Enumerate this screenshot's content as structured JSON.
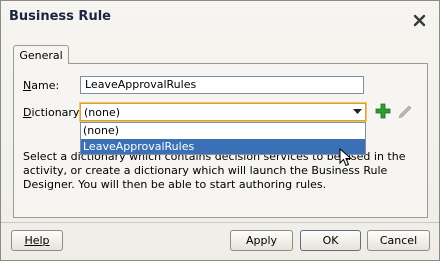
{
  "dialog": {
    "title": "Business Rule"
  },
  "tabs": [
    {
      "label": "General"
    }
  ],
  "form": {
    "name_label_prefix": "N",
    "name_label_rest": "ame:",
    "name_value": "LeaveApprovalRules",
    "dictionary_label_prefix": "D",
    "dictionary_label_rest": "ictionary:",
    "dictionary_selected": "(none)",
    "dictionary_options": [
      "(none)",
      "LeaveApprovalRules"
    ],
    "help_text": "Select a dictionary which contains decision services to be used in the activity, or create a dictionary which will launch the Business Rule Designer. You will then be able to start authoring rules."
  },
  "buttons": {
    "help": "Help",
    "apply": "Apply",
    "ok": "OK",
    "cancel": "Cancel"
  },
  "icons": {
    "close": "close-icon",
    "add": "add-icon",
    "edit": "pencil-icon",
    "dropdown": "chevron-down-icon"
  },
  "colors": {
    "selection": "#3b6fb6",
    "add_icon": "#2e9d2e",
    "focus_border": "#d4a23a"
  }
}
